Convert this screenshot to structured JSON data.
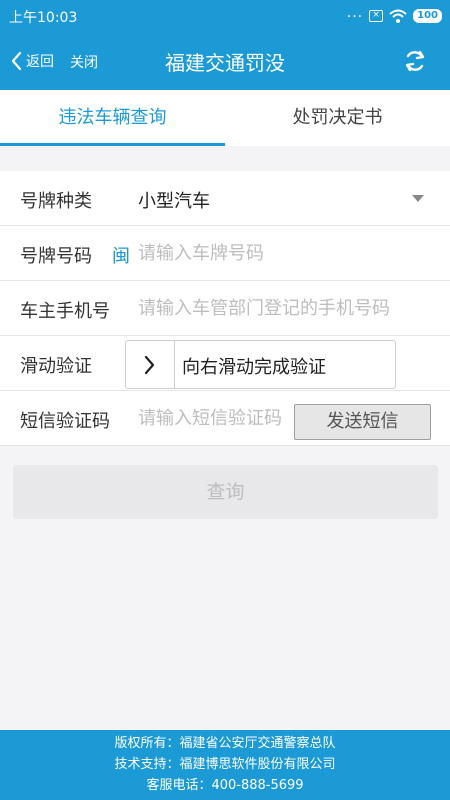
{
  "status_bar": {
    "time": "上午10:03",
    "dots": "...",
    "battery": "100",
    "icons": [
      "more-dots-icon",
      "sim-x-icon",
      "wifi-icon",
      "battery-icon"
    ]
  },
  "header": {
    "back_label": "返回",
    "close_label": "关闭",
    "title": "福建交通罚没",
    "refresh_icon": "refresh-icon"
  },
  "tabs": [
    {
      "label": "违法车辆查询",
      "active": true
    },
    {
      "label": "处罚决定书",
      "active": false
    }
  ],
  "form": {
    "plate_type": {
      "label": "号牌种类",
      "value": "小型汽车"
    },
    "plate_number": {
      "label": "号牌号码",
      "prefix": "闽",
      "placeholder": "请输入车牌号码"
    },
    "owner_phone": {
      "label": "车主手机号",
      "placeholder": "请输入车管部门登记的手机号码"
    },
    "slide_verify": {
      "label": "滑动验证",
      "text": "向右滑动完成验证"
    },
    "sms_code": {
      "label": "短信验证码",
      "placeholder": "请输入短信验证码",
      "button": "发送短信"
    }
  },
  "query_button": "查询",
  "footer": {
    "copyright": "版权所有：福建省公安厅交通警察总队",
    "tech_support": "技术支持：福建博思软件股份有限公司",
    "hotline": "客服电话：400-888-5699"
  },
  "colors": {
    "primary": "#1c9ad6",
    "background": "#f4f4f6",
    "disabled_button": "#e8e8ea"
  }
}
